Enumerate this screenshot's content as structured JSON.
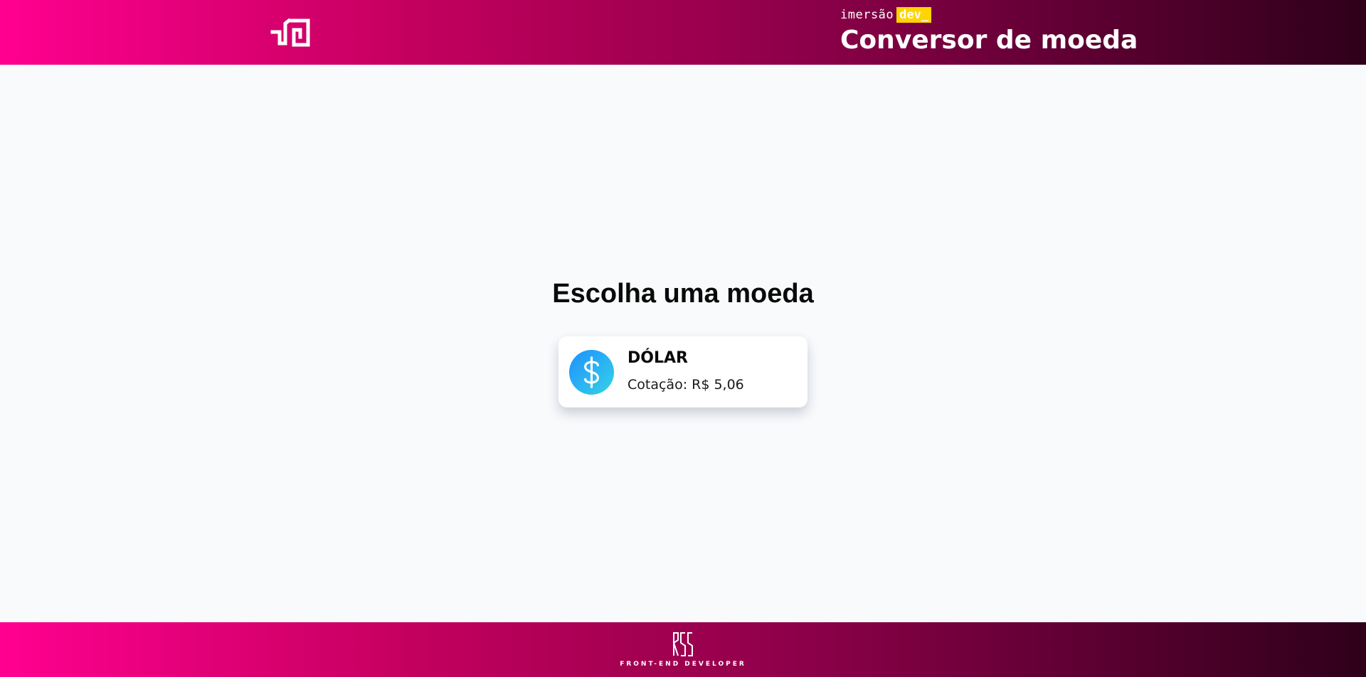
{
  "header": {
    "logo_icon": "imersao-logo-icon",
    "brand_prefix": "imersão",
    "brand_highlight": "dev_",
    "title": "Conversor de moeda"
  },
  "main": {
    "heading": "Escolha uma moeda",
    "currencies": [
      {
        "name": "DÓLAR",
        "rate": "Cotação: R$ 5,06",
        "icon": "dollar-coin-icon"
      }
    ]
  },
  "footer": {
    "logo_icon": "rss-logo-icon",
    "caption": "FRONT-END DEVELOPER"
  },
  "colors": {
    "gradient_start": "#ff0090",
    "gradient_end": "#2e001a",
    "highlight": "#ffd400",
    "background": "#f8fafc",
    "coin_start": "#1e90ff",
    "coin_end": "#36d3e6"
  }
}
